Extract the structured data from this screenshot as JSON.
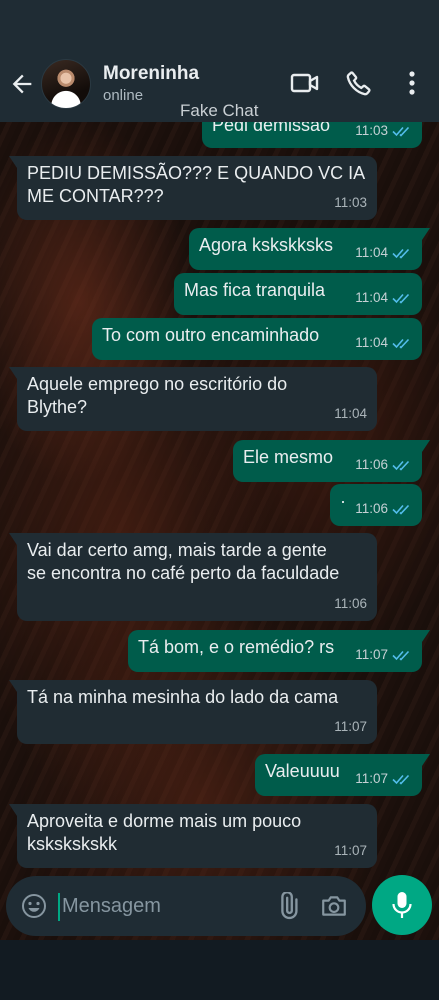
{
  "header": {
    "contact_name": "Moreninha",
    "contact_status": "online"
  },
  "watermark": "Fake Chat",
  "messages": [
    {
      "direction": "out",
      "text": "Pedi demissão",
      "time": "11:03",
      "read": true
    },
    {
      "direction": "in",
      "text": "PEDIU DEMISSÃO??? E QUANDO VC IA\nME CONTAR???",
      "time": "11:03"
    },
    {
      "direction": "out",
      "text": "Agora kskskksks",
      "time": "11:04",
      "read": true
    },
    {
      "direction": "out",
      "text": "Mas fica tranquila",
      "time": "11:04",
      "read": true
    },
    {
      "direction": "out",
      "text": "To com outro encaminhado",
      "time": "11:04",
      "read": true
    },
    {
      "direction": "in",
      "text": "Aquele emprego no escritório do\nBlythe?",
      "time": "11:04"
    },
    {
      "direction": "out",
      "text": "Ele mesmo",
      "time": "11:06",
      "read": true
    },
    {
      "direction": "out",
      "text": "·",
      "time": "11:06",
      "read": true
    },
    {
      "direction": "in",
      "text": "Vai dar certo amg, mais tarde a gente\nse encontra no café perto da faculdade",
      "time": "11:06"
    },
    {
      "direction": "out",
      "text": "Tá bom, e o remédio? rs",
      "time": "11:07",
      "read": true
    },
    {
      "direction": "in",
      "text": "Tá na minha mesinha do lado da cama",
      "time": "11:07"
    },
    {
      "direction": "out",
      "text": "Valeuuuu",
      "time": "11:07",
      "read": true
    },
    {
      "direction": "in",
      "text": "Aproveita e dorme mais um pouco\nkskskskskk",
      "time": "11:07"
    }
  ],
  "composer": {
    "placeholder": "Mensagem"
  },
  "colors": {
    "header_bg": "#1f2c34",
    "incoming_bubble": "#202c33",
    "outgoing_bubble": "#005c4b",
    "accent": "#00a884",
    "read_tick": "#53bdeb"
  }
}
